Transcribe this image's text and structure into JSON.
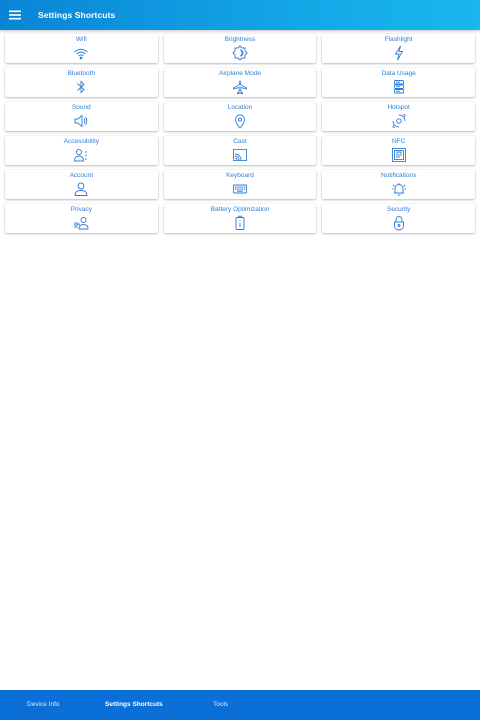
{
  "appbar": {
    "title": "Settings Shortcuts",
    "menu_icon": "hamburger-menu-icon"
  },
  "tiles": [
    {
      "label": "Wifi",
      "icon": "wifi-icon"
    },
    {
      "label": "Brightness",
      "icon": "brightness-icon"
    },
    {
      "label": "Flashlight",
      "icon": "flashlight-icon"
    },
    {
      "label": "Bluetooth",
      "icon": "bluetooth-icon"
    },
    {
      "label": "Airplane Mode",
      "icon": "airplane-icon"
    },
    {
      "label": "Data Usage",
      "icon": "data-usage-icon"
    },
    {
      "label": "Sound",
      "icon": "speaker-icon"
    },
    {
      "label": "Location",
      "icon": "location-pin-icon"
    },
    {
      "label": "Hotspot",
      "icon": "hotspot-icon"
    },
    {
      "label": "Accessibility",
      "icon": "accessibility-icon"
    },
    {
      "label": "Cast",
      "icon": "cast-icon"
    },
    {
      "label": "NFC",
      "icon": "nfc-icon"
    },
    {
      "label": "Account",
      "icon": "account-icon"
    },
    {
      "label": "Keyboard",
      "icon": "keyboard-icon"
    },
    {
      "label": "Notifications",
      "icon": "notification-bell-icon"
    },
    {
      "label": "Privacy",
      "icon": "privacy-icon"
    },
    {
      "label": "Battery Optimization",
      "icon": "battery-icon"
    },
    {
      "label": "Security",
      "icon": "lock-icon"
    }
  ],
  "bottom_nav": [
    {
      "label": "Device Info",
      "active": false
    },
    {
      "label": "Settings Shortcuts",
      "active": true
    },
    {
      "label": "Tools",
      "active": false
    }
  ],
  "colors": {
    "appbar_start": "#0a84d6",
    "appbar_end": "#19b7ee",
    "accent": "#2f7fd6",
    "bottom_nav": "#0b6fd8"
  }
}
